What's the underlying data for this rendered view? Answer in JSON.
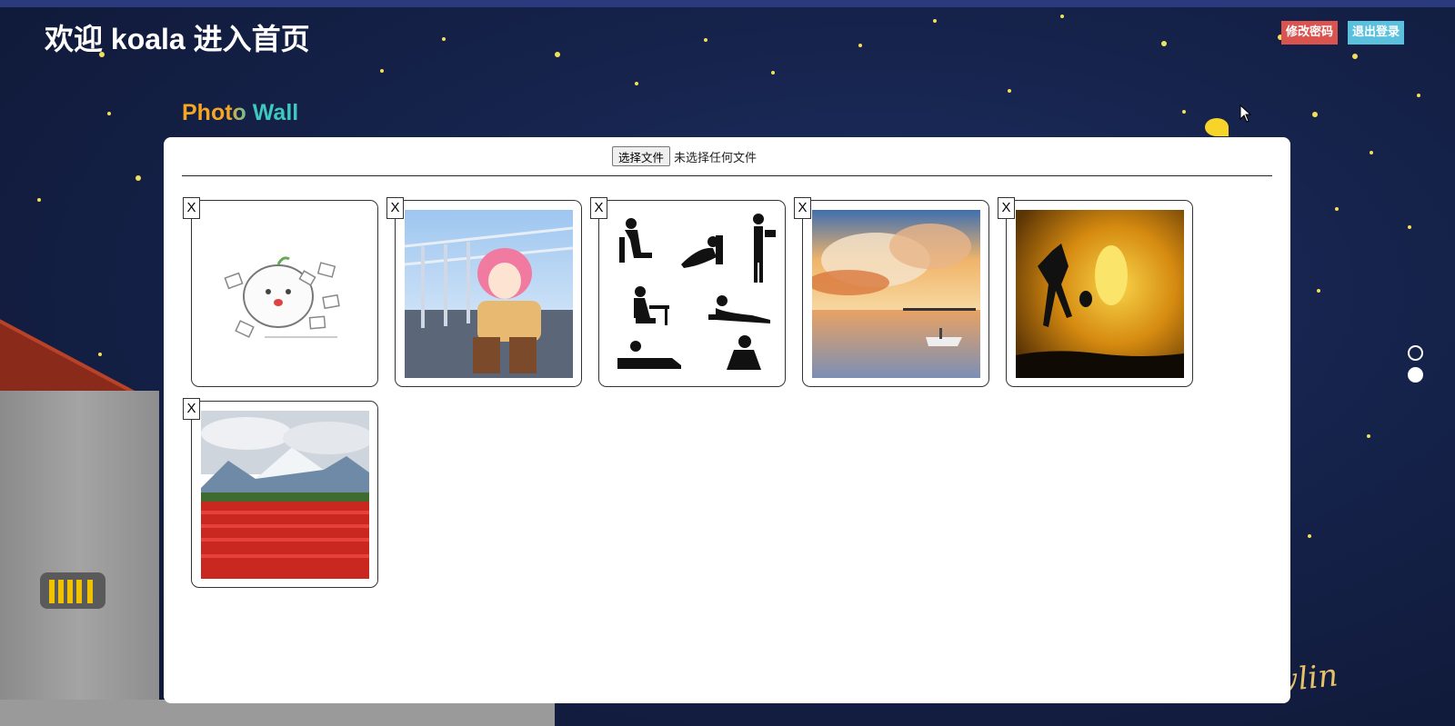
{
  "header": {
    "welcome": "欢迎 koala 进入首页",
    "change_password_label": "修改密码",
    "logout_label": "退出登录"
  },
  "photo_wall": {
    "title": "Photo Wall",
    "upload": {
      "choose_file_label": "选择文件",
      "no_file_text": "未选择任何文件"
    },
    "delete_label": "X",
    "photos": [
      {
        "subject": "doodle-homework"
      },
      {
        "subject": "anime-girl-stairs"
      },
      {
        "subject": "laptop-silhouettes"
      },
      {
        "subject": "sunset-sea-clouds"
      },
      {
        "subject": "jumping-silhouette-sun"
      },
      {
        "subject": "tulip-field-mountains"
      }
    ]
  },
  "carousel": {
    "dot_count": 2,
    "active_index": 1
  },
  "decor": {
    "signature": "owlin"
  },
  "colors": {
    "change_password_bg": "#d9534f",
    "logout_bg": "#5bc0de",
    "title_orange": "#f5a623",
    "title_teal": "#3ec9c0"
  }
}
